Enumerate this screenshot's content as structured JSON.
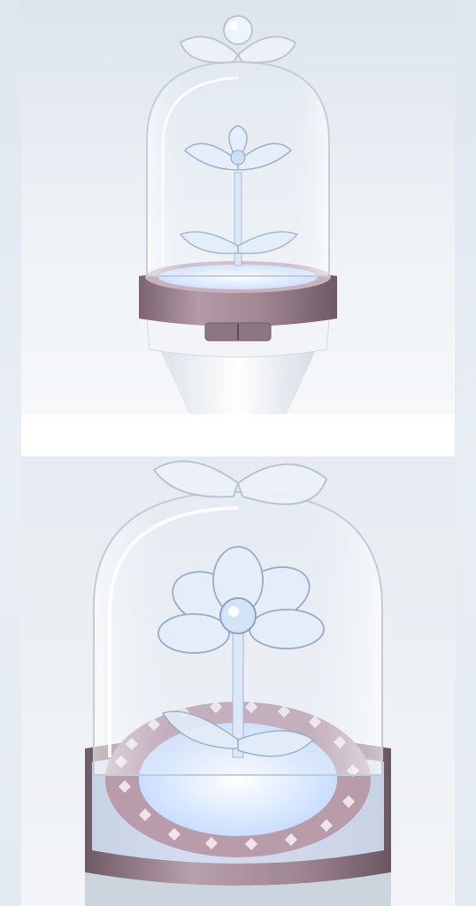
{
  "photos": [
    {
      "subject": "crystal-flower-lightstick-front"
    },
    {
      "subject": "crystal-flower-lightstick-closeup"
    }
  ],
  "colors": {
    "background": "#ffffff",
    "rail": "#e4eaf2",
    "photo_bg_top": "#e8edf3",
    "photo_bg_bottom": "#f4f6f9",
    "metal_ring": "#a48a94",
    "glass": "#eef3fa",
    "glow": "#cfe3ff"
  }
}
